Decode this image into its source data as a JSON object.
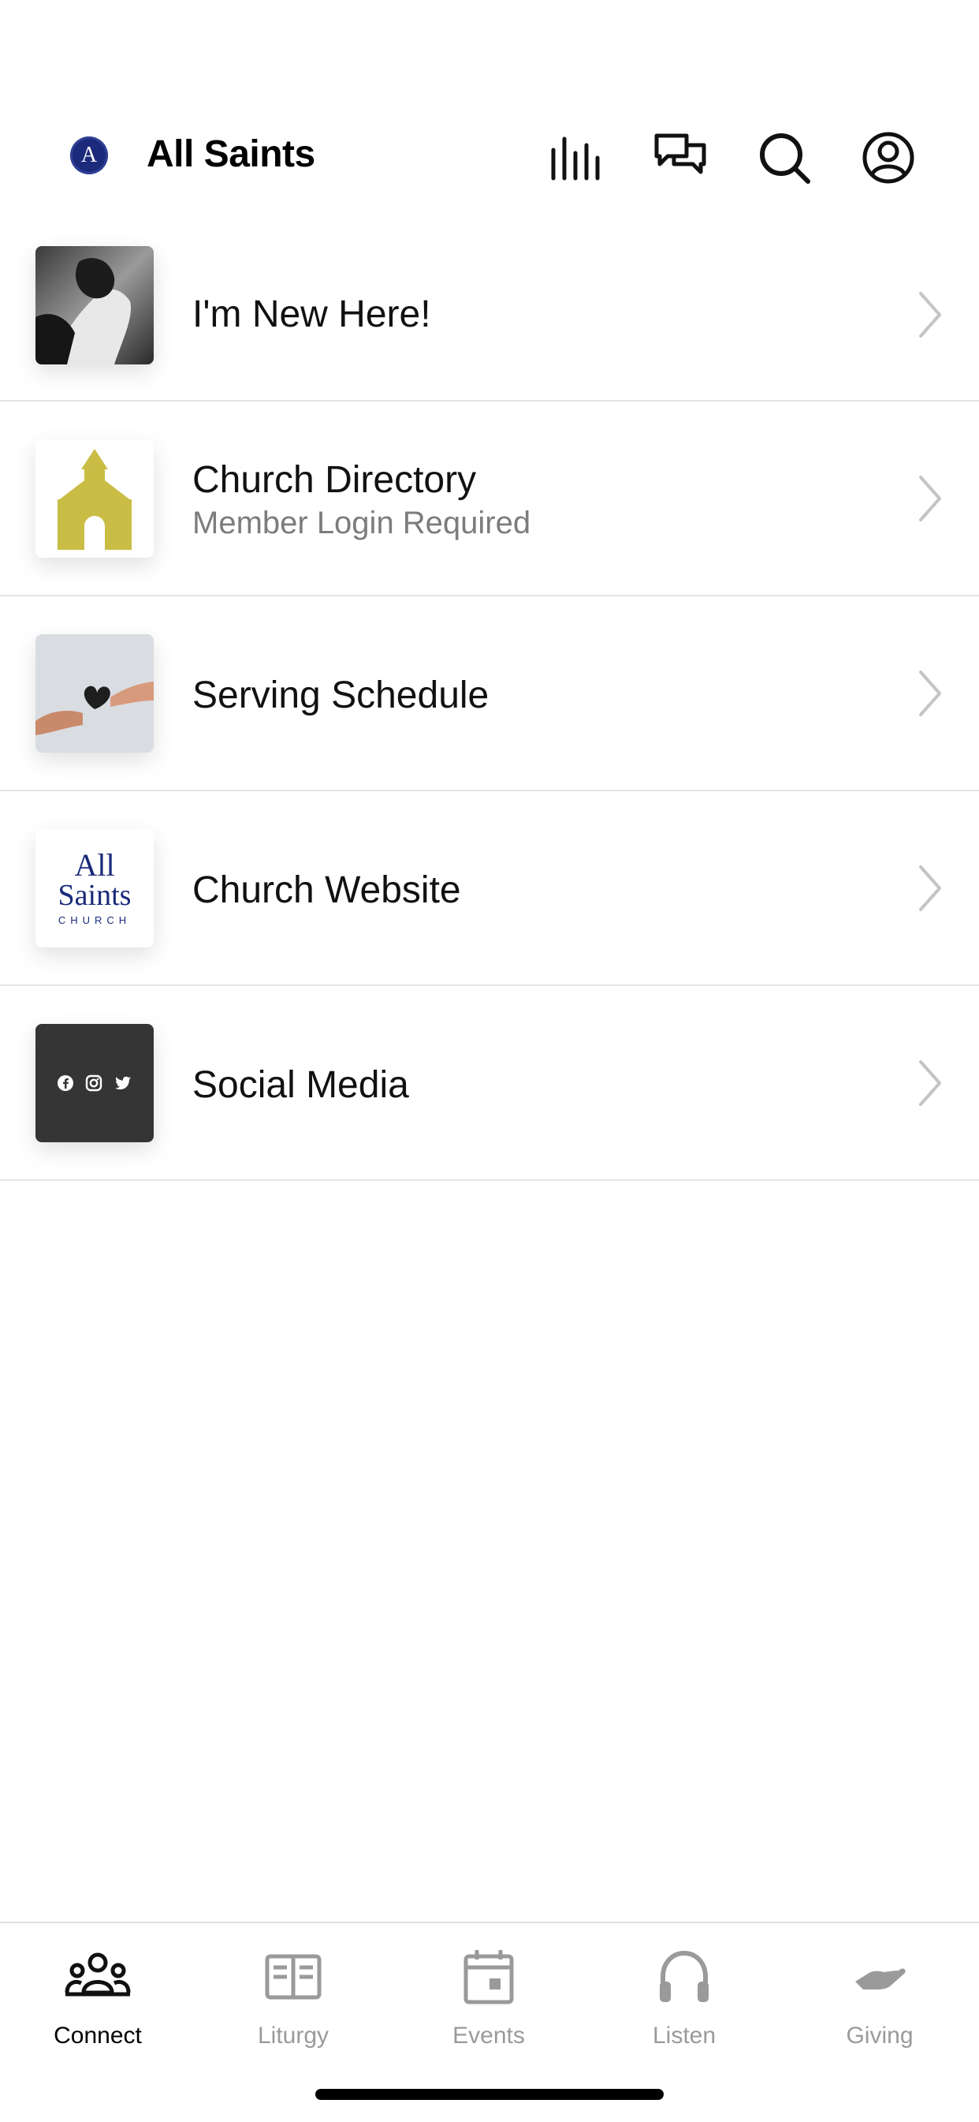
{
  "header": {
    "logo_letter": "A",
    "title": "All Saints",
    "icons": [
      "audio-bars-icon",
      "chat-bubbles-icon",
      "search-icon",
      "profile-icon"
    ]
  },
  "list": {
    "items": [
      {
        "title": "I'm New Here!",
        "subtitle": "",
        "thumb": "welcome-hands-photo"
      },
      {
        "title": "Church Directory",
        "subtitle": "Member Login Required",
        "thumb": "church-building-icon"
      },
      {
        "title": "Serving Schedule",
        "subtitle": "",
        "thumb": "heart-hands-photo"
      },
      {
        "title": "Church Website",
        "subtitle": "",
        "thumb": "all-saints-logo",
        "logo_line1": "All",
        "logo_line2": "Saints",
        "logo_line3": "CHURCH"
      },
      {
        "title": "Social Media",
        "subtitle": "",
        "thumb": "social-icons",
        "social_icons": [
          "facebook-icon",
          "instagram-icon",
          "twitter-icon"
        ]
      }
    ]
  },
  "tabbar": {
    "tabs": [
      {
        "label": "Connect",
        "icon": "people-group-icon",
        "active": true
      },
      {
        "label": "Liturgy",
        "icon": "open-book-icon",
        "active": false
      },
      {
        "label": "Events",
        "icon": "calendar-icon",
        "active": false
      },
      {
        "label": "Listen",
        "icon": "headphones-icon",
        "active": false
      },
      {
        "label": "Giving",
        "icon": "giving-hand-icon",
        "active": false
      }
    ]
  },
  "colors": {
    "logo_navy": "#1b2a7a",
    "church_gold": "#c9bd45",
    "divider": "#e4e4e4",
    "inactive_tab": "#9a9a9a"
  }
}
